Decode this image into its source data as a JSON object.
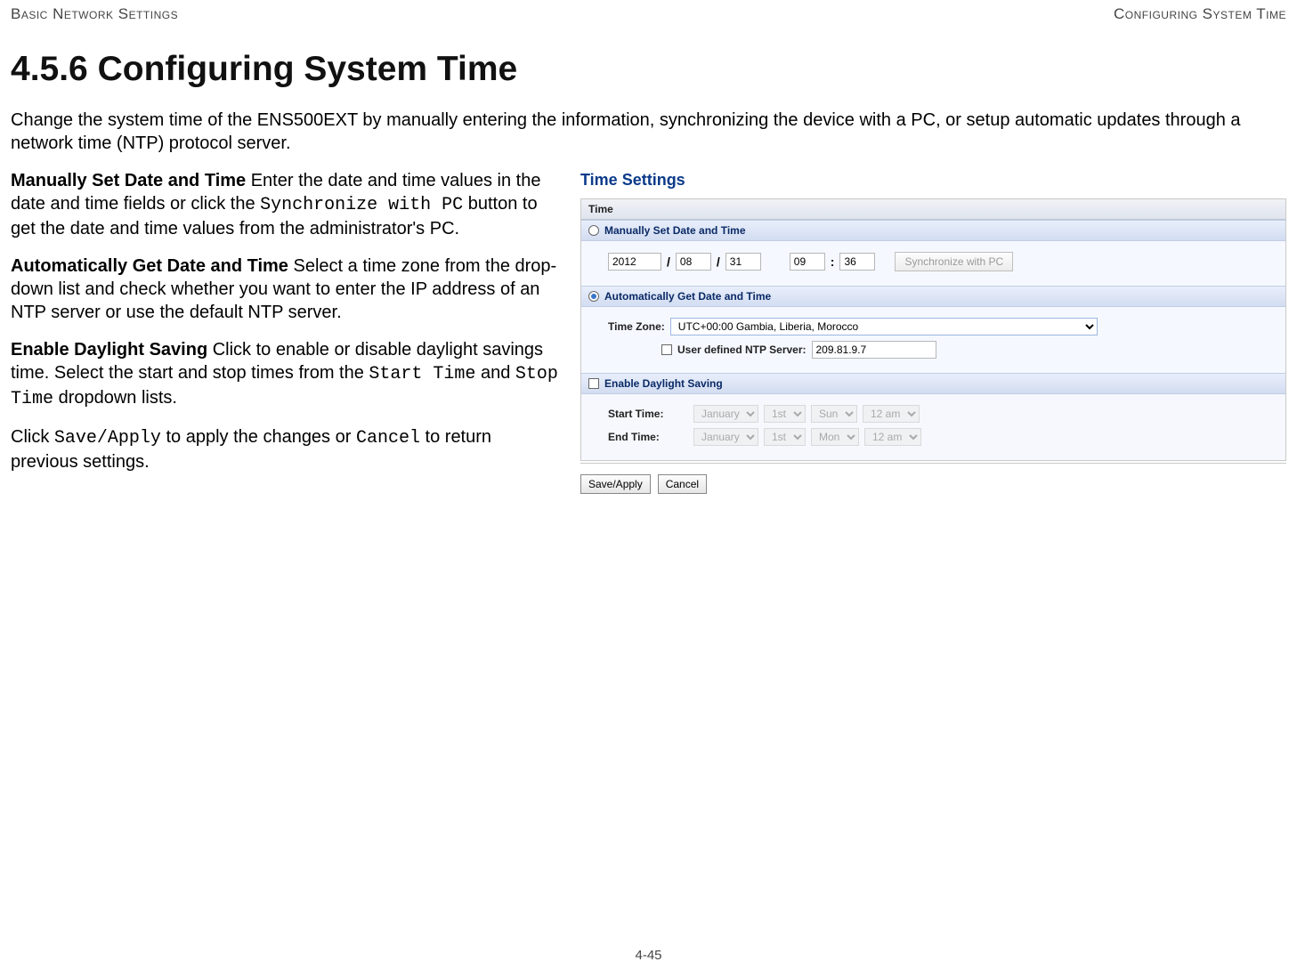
{
  "header": {
    "left": "Basic Network Settings",
    "right": "Configuring System Time"
  },
  "heading": "4.5.6 Configuring System Time",
  "intro": "Change the system time of the ENS500EXT by manually entering the information, synchronizing the device with a PC, or setup automatic updates through a network time (NTP) protocol server.",
  "paras": {
    "p1_bold": "Manually Set Date and Time",
    "p1_rest_a": "  Enter the date and time values in the date and time fields or click the ",
    "p1_mono": "Synchronize with PC",
    "p1_rest_b": " button to get the date and time values from the administrator's PC.",
    "p2_bold": "Automatically Get Date and Time",
    "p2_rest": "  Select a time zone from the drop-down list and check whether you want to enter the IP address of an NTP server or use the default NTP server.",
    "p3_bold": "Enable Daylight Saving",
    "p3_rest_a": "  Click to enable or disable daylight savings time. Select the start and stop times from the ",
    "p3_mono1": "Start Time",
    "p3_mid": " and ",
    "p3_mono2": "Stop Time",
    "p3_rest_b": " dropdown lists.",
    "p4_a": "Click ",
    "p4_mono1": "Save/Apply",
    "p4_b": " to apply the changes or ",
    "p4_mono2": "Cancel",
    "p4_c": " to return previous settings."
  },
  "panel": {
    "title": "Time Settings",
    "table_header": "Time",
    "manual": {
      "label": "Manually Set Date and Time",
      "year": "2012",
      "month": "08",
      "day": "31",
      "hour": "09",
      "minute": "36",
      "sync_btn": "Synchronize with PC"
    },
    "auto": {
      "label": "Automatically Get Date and Time",
      "tz_label": "Time Zone:",
      "tz_value": "UTC+00:00 Gambia, Liberia, Morocco",
      "ntp_label": "User defined NTP Server:",
      "ntp_value": "209.81.9.7"
    },
    "dst": {
      "label": "Enable Daylight Saving",
      "start_label": "Start Time:",
      "end_label": "End Time:",
      "month1": "January",
      "day1": "1st",
      "dow1": "Sun",
      "hr1": "12 am",
      "month2": "January",
      "day2": "1st",
      "dow2": "Mon",
      "hr2": "12 am"
    },
    "buttons": {
      "save": "Save/Apply",
      "cancel": "Cancel"
    }
  },
  "page_number": "4-45"
}
